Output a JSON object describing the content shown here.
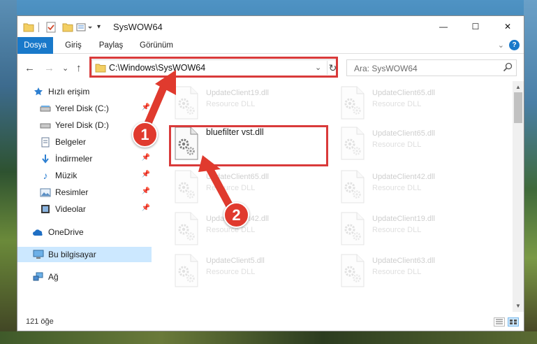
{
  "window": {
    "title": "SysWOW64",
    "controls": {
      "minimize": "—",
      "maximize": "☐",
      "close": "✕"
    }
  },
  "ribbon": {
    "tabs": [
      "Dosya",
      "Giriş",
      "Paylaş",
      "Görünüm"
    ],
    "help": "?"
  },
  "nav": {
    "back": "←",
    "forward": "→",
    "recent": "⌄",
    "up": "↑",
    "address": "C:\\Windows\\SysWOW64",
    "refresh": "↻",
    "search_placeholder": "Ara: SysWOW64"
  },
  "sidebar": {
    "items": [
      {
        "label": "Hızlı erişim",
        "icon": "star-icon"
      },
      {
        "label": "Yerel Disk (C:)",
        "icon": "drive-icon",
        "pinned": true
      },
      {
        "label": "Yerel Disk (D:)",
        "icon": "drive-icon"
      },
      {
        "label": "Belgeler",
        "icon": "document-icon",
        "pinned": true
      },
      {
        "label": "İndirmeler",
        "icon": "download-icon",
        "pinned": true
      },
      {
        "label": "Müzik",
        "icon": "music-icon",
        "pinned": true
      },
      {
        "label": "Resimler",
        "icon": "pictures-icon",
        "pinned": true
      },
      {
        "label": "Videolar",
        "icon": "video-icon",
        "pinned": true
      },
      {
        "label": "OneDrive",
        "icon": "cloud-icon"
      },
      {
        "label": "Bu bilgisayar",
        "icon": "computer-icon",
        "selected": true
      },
      {
        "label": "Ağ",
        "icon": "network-icon"
      }
    ],
    "pin_glyph": "📌"
  },
  "files": [
    {
      "name": "UpdateClient19.dll",
      "type": "Resource DLL"
    },
    {
      "name": "UpdateClient65.dll",
      "type": "Resource DLL"
    },
    {
      "name": "bluefilter vst.dll",
      "type": ""
    },
    {
      "name": "UpdateClient65.dll",
      "type": "Resource DLL"
    },
    {
      "name": "UpdateClient65.dll",
      "type": "Resource DLL"
    },
    {
      "name": "UpdateClient42.dll",
      "type": "Resource DLL"
    },
    {
      "name": "UpdateClient42.dll",
      "type": "Resource DLL"
    },
    {
      "name": "UpdateClient19.dll",
      "type": "Resource DLL"
    },
    {
      "name": "UpdateClient5.dll",
      "type": "Resource DLL"
    },
    {
      "name": "UpdateClient63.dll",
      "type": "Resource DLL"
    }
  ],
  "status": {
    "count": "121 öğe"
  },
  "annotations": {
    "step1": "1",
    "step2": "2"
  },
  "colors": {
    "accent": "#1979ca",
    "highlight": "#d93a3a",
    "badge": "#e03a2e"
  }
}
